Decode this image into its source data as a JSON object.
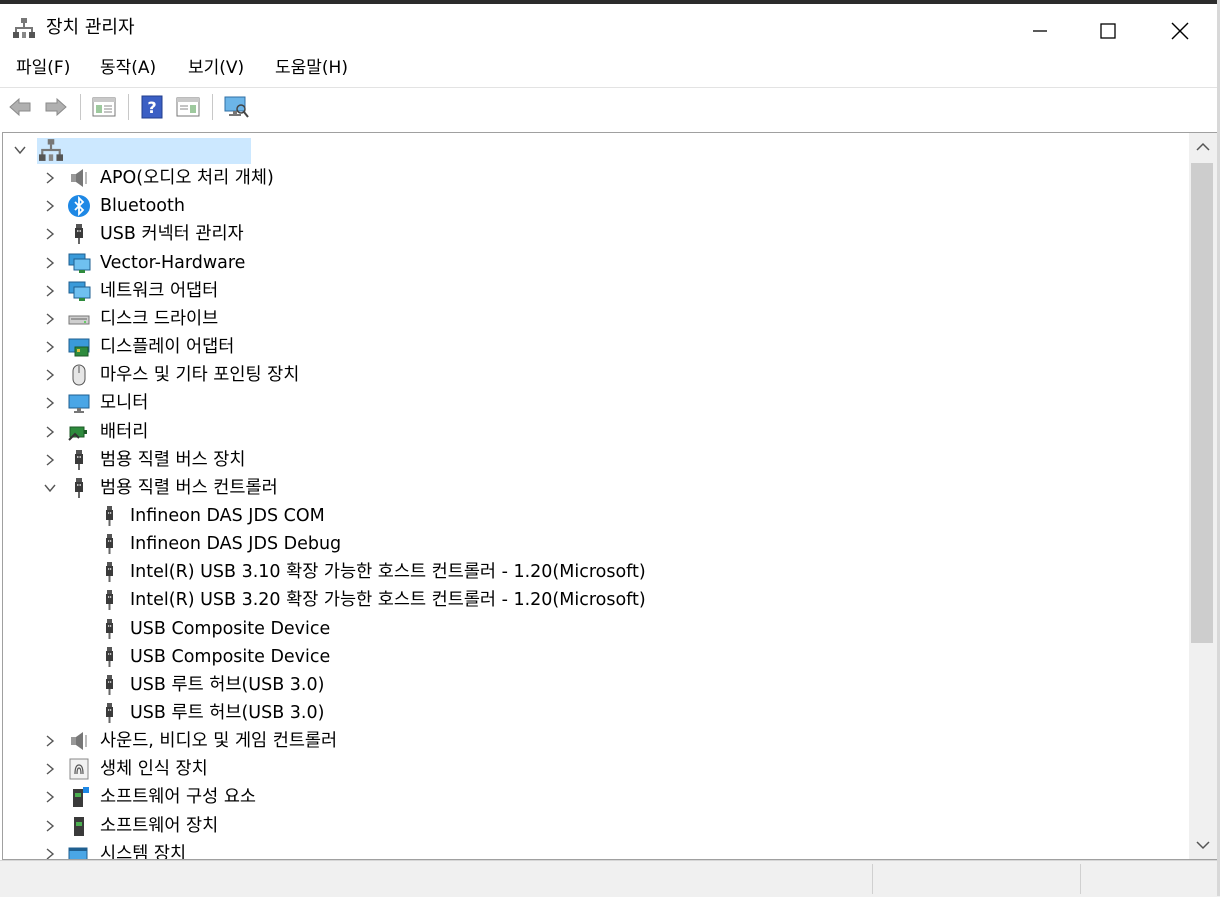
{
  "window": {
    "title": "장치 관리자"
  },
  "menu": [
    {
      "label": "파일(F)"
    },
    {
      "label": "동작(A)"
    },
    {
      "label": "보기(V)"
    },
    {
      "label": "도움말(H)"
    }
  ],
  "toolbar": {
    "icons": [
      "back-arrow-icon",
      "forward-arrow-icon",
      "properties-pane-icon",
      "help-icon",
      "properties-icon",
      "scan-hardware-icon"
    ]
  },
  "tree": {
    "root": {
      "label": ""
    },
    "categories": [
      {
        "label": "APO(오디오 처리 개체)",
        "icon": "speaker-icon",
        "expanded": false
      },
      {
        "label": "Bluetooth",
        "icon": "bluetooth-icon",
        "expanded": false
      },
      {
        "label": "USB 커넥터 관리자",
        "icon": "usb-plug-icon",
        "expanded": false
      },
      {
        "label": "Vector-Hardware",
        "icon": "network-monitor-icon",
        "expanded": false
      },
      {
        "label": "네트워크 어댑터",
        "icon": "network-monitor-icon",
        "expanded": false
      },
      {
        "label": "디스크 드라이브",
        "icon": "disk-drive-icon",
        "expanded": false
      },
      {
        "label": "디스플레이 어댑터",
        "icon": "display-adapter-icon",
        "expanded": false
      },
      {
        "label": "마우스 및 기타 포인팅 장치",
        "icon": "mouse-icon",
        "expanded": false
      },
      {
        "label": "모니터",
        "icon": "monitor-icon",
        "expanded": false
      },
      {
        "label": "배터리",
        "icon": "battery-icon",
        "expanded": false
      },
      {
        "label": "범용 직렬 버스 장치",
        "icon": "usb-plug-icon",
        "expanded": false
      },
      {
        "label": "범용 직렬 버스 컨트롤러",
        "icon": "usb-plug-icon",
        "expanded": true,
        "children": [
          {
            "label": "Infineon DAS JDS COM"
          },
          {
            "label": "Infineon DAS JDS Debug"
          },
          {
            "label": "Intel(R) USB 3.10 확장 가능한 호스트 컨트롤러 - 1.20(Microsoft)"
          },
          {
            "label": "Intel(R) USB 3.20 확장 가능한 호스트 컨트롤러 - 1.20(Microsoft)"
          },
          {
            "label": "USB Composite Device"
          },
          {
            "label": "USB Composite Device"
          },
          {
            "label": "USB 루트 허브(USB 3.0)"
          },
          {
            "label": "USB 루트 허브(USB 3.0)"
          }
        ]
      },
      {
        "label": "사운드, 비디오 및 게임 컨트롤러",
        "icon": "speaker-icon",
        "expanded": false
      },
      {
        "label": "생체 인식 장치",
        "icon": "fingerprint-icon",
        "expanded": false
      },
      {
        "label": "소프트웨어 구성 요소",
        "icon": "software-component-icon",
        "expanded": false
      },
      {
        "label": "소프트웨어 장치",
        "icon": "software-device-icon",
        "expanded": false
      },
      {
        "label": "시스템 장치",
        "icon": "system-device-icon",
        "expanded": false
      }
    ]
  },
  "colors": {
    "selection": "#cce8ff",
    "accent": "#1e88e5"
  }
}
